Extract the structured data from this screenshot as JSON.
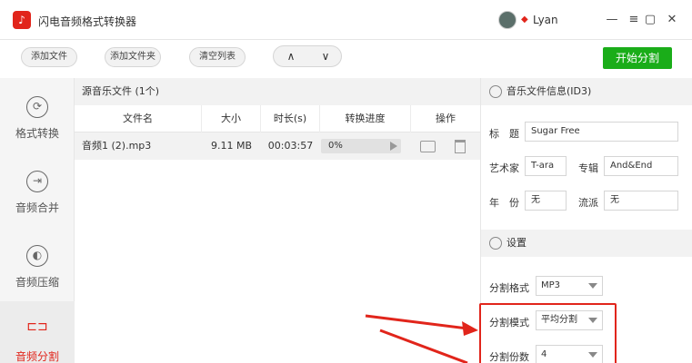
{
  "app": {
    "title": "闪电音频格式转换器",
    "logo_icon": "music-note-icon",
    "username": "Lyan"
  },
  "window_controls": [
    "—",
    "▢",
    "✕"
  ],
  "toolbar": {
    "add_file": "添加文件",
    "add_folder": "添加文件夹",
    "clear_list": "清空列表",
    "move_up": "∧",
    "move_down": "∨",
    "start": "开始分割"
  },
  "sidebar": {
    "items": [
      {
        "label": "格式转换",
        "icon": "refresh-icon",
        "glyph": "⟳"
      },
      {
        "label": "音频合并",
        "icon": "merge-icon",
        "glyph": "⇥"
      },
      {
        "label": "音频压缩",
        "icon": "compress-icon",
        "glyph": "◐"
      },
      {
        "label": "音频分割",
        "icon": "split-icon",
        "glyph": "⊏⊐"
      }
    ]
  },
  "file_list": {
    "count_label": "源音乐文件 (1个)",
    "columns": [
      "文件名",
      "大小",
      "时长(s)",
      "转换进度",
      "操作"
    ],
    "rows": [
      {
        "name": "音频1 (2).mp3",
        "size": "9.11 MB",
        "duration": "00:03:57",
        "progress": "0%",
        "progress_fraction": 0
      }
    ]
  },
  "info_panel": {
    "title": "音乐文件信息(ID3)",
    "fields": {
      "title_label": "标　题",
      "title_value": "Sugar Free",
      "artist_label": "艺术家",
      "artist_value": "T-ara",
      "album_label": "专辑",
      "album_value": "And&End",
      "year_label": "年　份",
      "year_value": "无",
      "genre_label": "流派",
      "genre_value": "无"
    }
  },
  "settings": {
    "title": "设置",
    "format_label": "分割格式",
    "format_value": "MP3",
    "mode_label": "分割模式",
    "mode_value": "平均分割",
    "parts_label": "分割份数",
    "parts_value": "4"
  },
  "colors": {
    "accent": "#1aad19",
    "highlight": "#e1251b"
  }
}
